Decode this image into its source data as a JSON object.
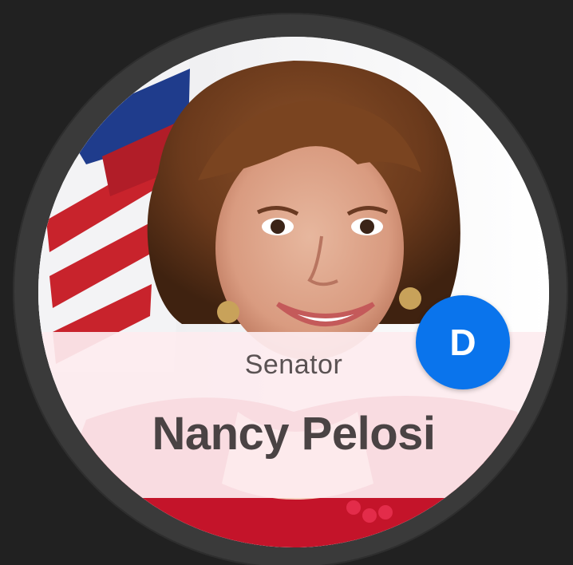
{
  "card": {
    "title": "Senator",
    "name": "Nancy Pelosi",
    "party_badge": "D",
    "photo_icon": "portrait-photo"
  },
  "colors": {
    "background": "#212121",
    "bezel": "#3a3a3a",
    "panel": "#fdecef",
    "badge": "#0a74ec",
    "name_text": "#4a4344"
  }
}
